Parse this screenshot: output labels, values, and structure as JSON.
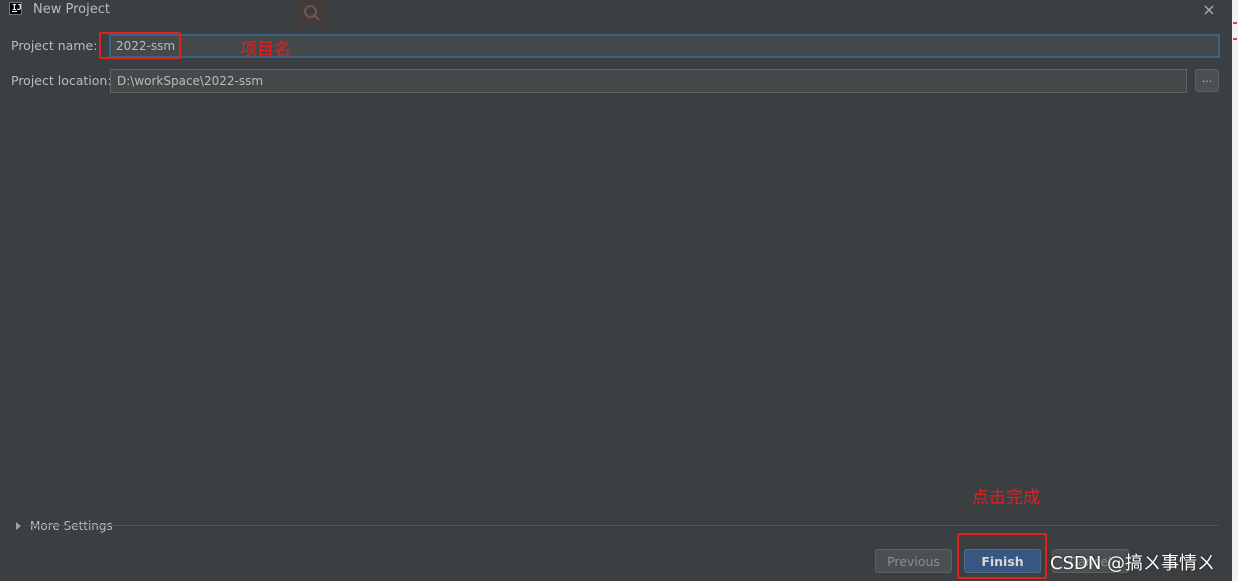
{
  "window": {
    "title": "New Project"
  },
  "form": {
    "name_label": "Project name:",
    "name_value": "2022-ssm",
    "location_label": "Project location:",
    "location_value": "D:\\workSpace\\2022-ssm",
    "browse_label": "..."
  },
  "more_settings": {
    "label": "More Settings"
  },
  "buttons": {
    "previous": "Previous",
    "finish": "Finish",
    "cancel": "Cancel"
  },
  "annotations": {
    "project_name": "项目名",
    "click_finish": "点击完成"
  },
  "watermark": "CSDN @搞ㄨ事情ㄨ",
  "colors": {
    "background": "#3c3f41",
    "field": "#45494a",
    "focus": "#3d6185",
    "annotation": "#e3201c",
    "primary_button": "#365880"
  }
}
